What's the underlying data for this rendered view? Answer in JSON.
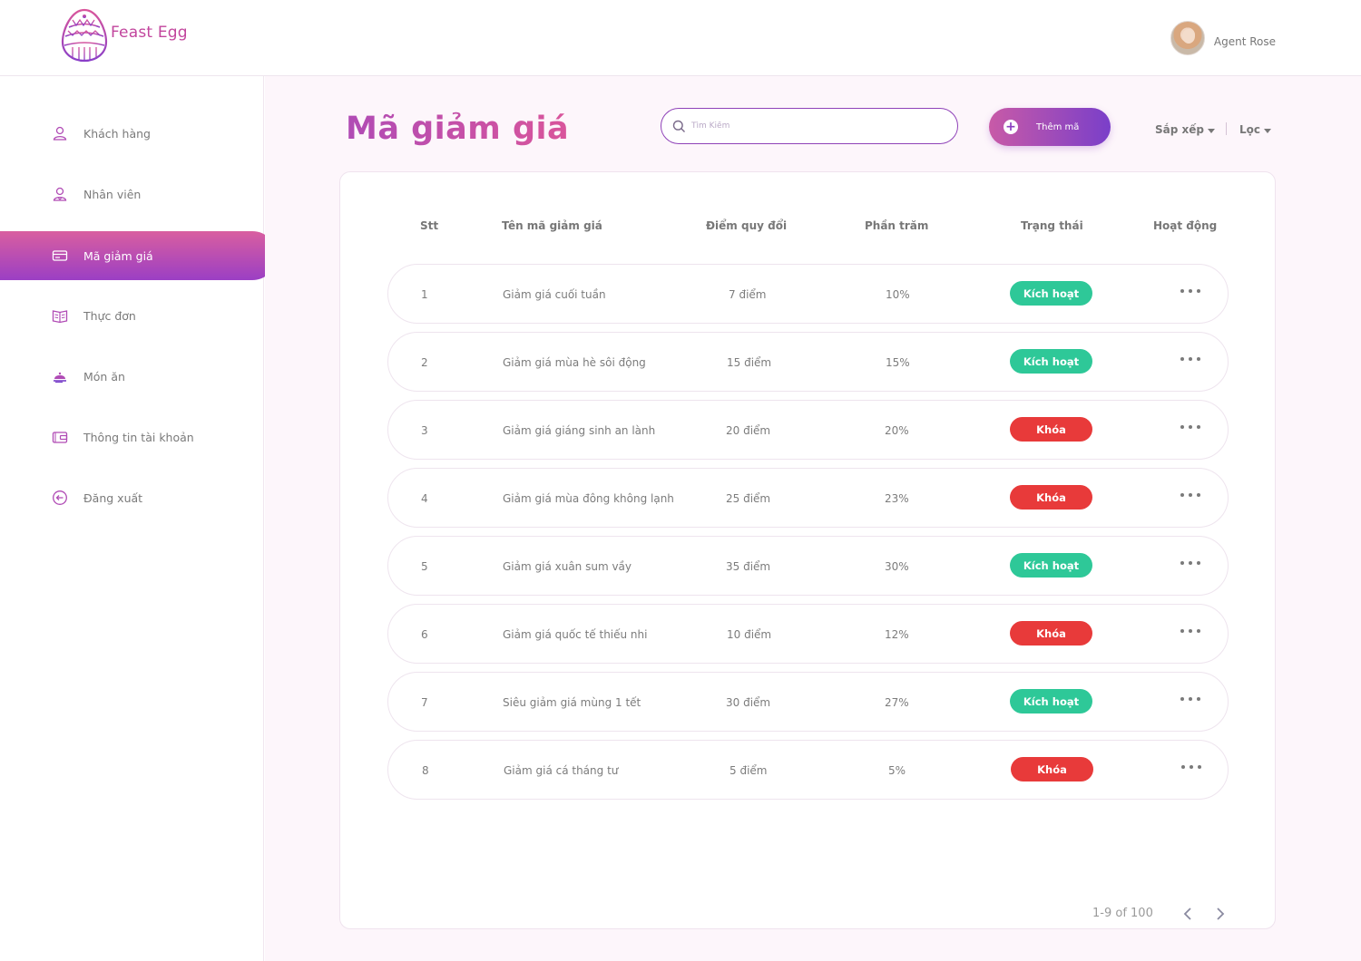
{
  "app": {
    "name": "Feast Egg",
    "user_name": "Agent Rose"
  },
  "sidebar": {
    "items": [
      {
        "label": "Khách hàng",
        "icon": "user-icon"
      },
      {
        "label": "Nhân viên",
        "icon": "staff-icon"
      },
      {
        "label": "Mã giảm giá",
        "icon": "ticket-icon",
        "active": true
      },
      {
        "label": "Thực đơn",
        "icon": "menu-book-icon"
      },
      {
        "label": "Món ăn",
        "icon": "food-cloche-icon"
      },
      {
        "label": "Thông tin tài khoản",
        "icon": "wallet-icon"
      },
      {
        "label": "Đăng xuất",
        "icon": "logout-icon"
      }
    ]
  },
  "page": {
    "title": "Mã giảm giá",
    "search_placeholder": "Tìm Kiếm",
    "add_label": "Thêm mã",
    "sort_label": "Sắp xếp",
    "filter_label": "Lọc"
  },
  "table": {
    "headers": [
      "Stt",
      "Tên mã giảm giá",
      "Điểm quy đổi",
      "Phần trăm",
      "Trạng thái",
      "Hoạt động"
    ],
    "rows": [
      {
        "stt": "1",
        "name": "Giảm giá cuối tuần",
        "points": "7 điểm",
        "percent": "10%",
        "status": "Kích hoạt",
        "active": true
      },
      {
        "stt": "2",
        "name": "Giảm giá mùa hè sôi động",
        "points": "15 điểm",
        "percent": "15%",
        "status": "Kích hoạt",
        "active": true
      },
      {
        "stt": "3",
        "name": "Giảm giá giáng sinh an lành",
        "points": "20 điểm",
        "percent": "20%",
        "status": "Khóa",
        "active": false
      },
      {
        "stt": "4",
        "name": "Giảm giá mùa đông không lạnh",
        "points": "25 điểm",
        "percent": "23%",
        "status": "Khóa",
        "active": false
      },
      {
        "stt": "5",
        "name": "Giảm giá xuân sum vầy",
        "points": "35 điểm",
        "percent": "30%",
        "status": "Kích hoạt",
        "active": true
      },
      {
        "stt": "6",
        "name": "Giảm giá quốc tế thiếu nhi",
        "points": "10 điểm",
        "percent": "12%",
        "status": "Khóa",
        "active": false
      },
      {
        "stt": "7",
        "name": "Siêu giảm giá mùng 1 tết",
        "points": "30 điểm",
        "percent": "27%",
        "status": "Kích hoạt",
        "active": true
      },
      {
        "stt": "8",
        "name": "Giảm giá cá tháng tư",
        "points": "5 điểm",
        "percent": "5%",
        "status": "Khóa",
        "active": false
      }
    ]
  },
  "pagination": {
    "text": "1-9 of 100"
  },
  "colors": {
    "brand": "#c2459d",
    "accent_purple": "#8f42b8",
    "status_active": "#2ec898",
    "status_locked": "#e83a3a"
  }
}
